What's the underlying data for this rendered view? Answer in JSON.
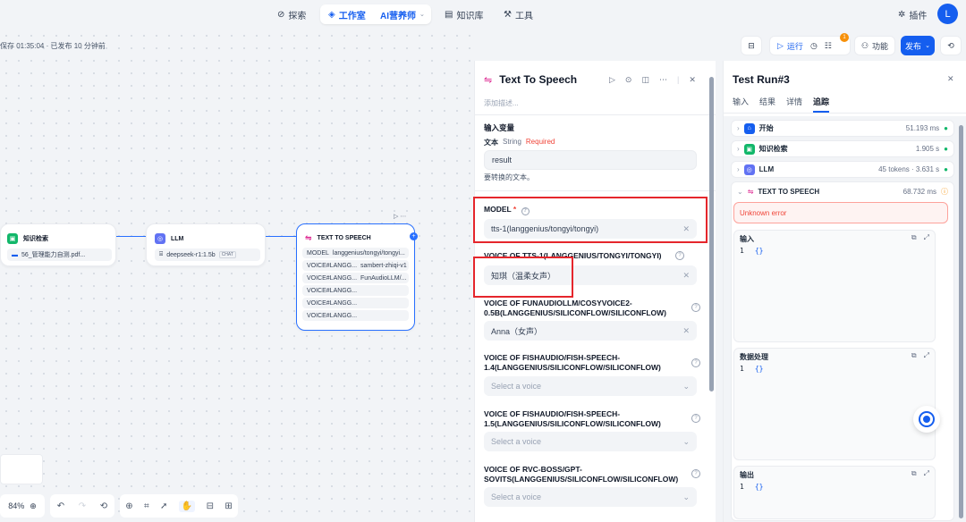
{
  "topnav": {
    "explore": "探索",
    "studio": "工作室",
    "app_name": "AI营养师",
    "knowledge": "知识库",
    "tools": "工具",
    "plugins": "插件",
    "avatar": "L"
  },
  "status": {
    "saved": "保存 01:35:04 · 已发布 10 分钟前"
  },
  "toolbar": {
    "run": "运行",
    "features": "功能",
    "publish": "发布",
    "badge": "1"
  },
  "canvas": {
    "zoom": "84%",
    "node_knowledge": {
      "title": "知识检索",
      "file": "56_管理能力自测.pdf..."
    },
    "node_llm": {
      "title": "LLM",
      "model": "deepseek-r1:1.5b",
      "tag": "CHAT"
    },
    "node_tts": {
      "title": "TEXT TO SPEECH",
      "rows": [
        {
          "key": "MODEL",
          "val": "langgenius/tongyi/tongyi..."
        },
        {
          "key": "VOICE#LANGG...",
          "val": "sambert-zhiqi-v1"
        },
        {
          "key": "VOICE#LANGG...",
          "val": "FunAudioLLM/..."
        },
        {
          "key": "VOICE#LANGG...",
          "val": ""
        },
        {
          "key": "VOICE#LANGG...",
          "val": ""
        },
        {
          "key": "VOICE#LANGG...",
          "val": ""
        }
      ]
    }
  },
  "panel": {
    "title": "Text To Speech",
    "desc_placeholder": "添加描述...",
    "input_section": "输入变量",
    "var_name": "文本",
    "var_type": "String",
    "var_required": "Required",
    "var_value": "result",
    "var_desc": "要转换的文本。",
    "model_label": "MODEL",
    "model_star": "*",
    "model_value": "tts-1(langgenius/tongyi/tongyi)",
    "voice1_label": "VOICE OF TTS-1(LANGGENIUS/TONGYI/TONGYI)",
    "voice1_value": "知琪（温柔女声）",
    "voice2_label": "VOICE OF FUNAUDIOLLM/COSYVOICE2-0.5B(LANGGENIUS/SILICONFLOW/SILICONFLOW)",
    "voice2_value": "Anna（女声）",
    "voice3_label": "VOICE OF FISHAUDIO/FISH-SPEECH-1.4(LANGGENIUS/SILICONFLOW/SILICONFLOW)",
    "voice3_placeholder": "Select a voice",
    "voice4_label": "VOICE OF FISHAUDIO/FISH-SPEECH-1.5(LANGGENIUS/SILICONFLOW/SILICONFLOW)",
    "voice4_placeholder": "Select a voice",
    "voice5_label": "VOICE OF RVC-BOSS/GPT-SOVITS(LANGGENIUS/SILICONFLOW/SILICONFLOW)",
    "voice5_placeholder": "Select a voice"
  },
  "run": {
    "title": "Test Run#3",
    "tabs": [
      "输入",
      "结果",
      "详情",
      "追踪"
    ],
    "active_tab": "追踪",
    "traces": [
      {
        "name": "开始",
        "time": "51.193 ms",
        "status": "ok",
        "color": "#155eef"
      },
      {
        "name": "知识检索",
        "time": "1.905 s",
        "status": "ok",
        "color": "#12b76a"
      },
      {
        "name": "LLM",
        "time": "45 tokens · 3.631 s",
        "status": "ok",
        "color": "#6172f3"
      },
      {
        "name": "TEXT TO SPEECH",
        "time": "68.732 ms",
        "status": "error",
        "color": "#dd2590"
      }
    ],
    "error": "Unknown error",
    "input_label": "输入",
    "process_label": "数据处理",
    "output_label": "输出",
    "code_line": "1",
    "code_value": "{}"
  }
}
